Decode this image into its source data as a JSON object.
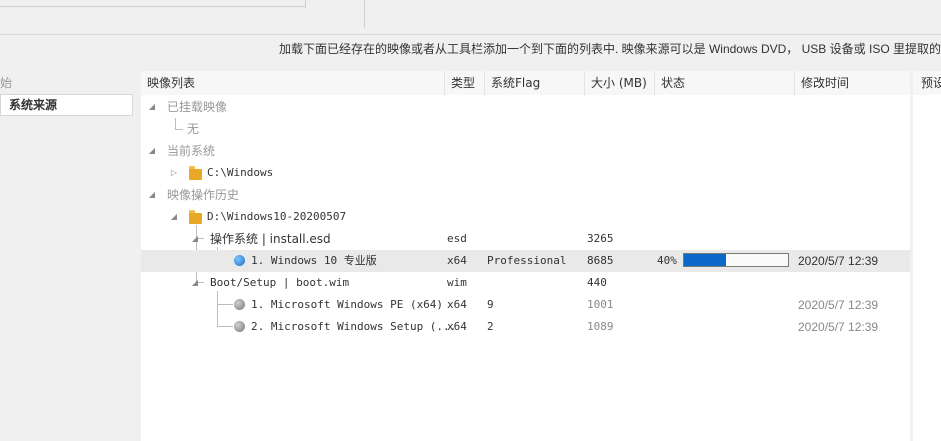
{
  "hint_text": "加载下面已经存在的映像或者从工具栏添加一个到下面的列表中. 映像来源可以是 Windows DVD， USB 设备或 ISO 里提取的",
  "sidebar": {
    "head_label": "始",
    "items": [
      {
        "label": "系统来源"
      }
    ]
  },
  "table": {
    "columns": [
      "映像列表",
      "类型",
      "系统Flag",
      "大小 (MB)",
      "状态",
      "修改时间"
    ],
    "right_header": "预设"
  },
  "tree": {
    "mounted": {
      "label": "已挂载映像",
      "child": "无"
    },
    "current": {
      "label": "当前系统",
      "child": "C:\\Windows"
    },
    "history": {
      "label": "映像操作历史",
      "folder": "D:\\Windows10-20200507",
      "groups": [
        {
          "label": "操作系统  |  install.esd",
          "type": "esd",
          "size": "3265",
          "items": [
            {
              "name": "1. Windows 10 专业版",
              "type": "x64",
              "flag": "Professional",
              "size": "8685",
              "status": "40%",
              "progress": 0.4,
              "time": "2020/5/7 12:39"
            }
          ]
        },
        {
          "label": "Boot/Setup  |  boot.wim",
          "type": "wim",
          "size": "440",
          "items": [
            {
              "name": "1. Microsoft Windows PE (x64)",
              "type": "x64",
              "flag": "9",
              "size": "1001",
              "status": "",
              "time": "2020/5/7 12:39"
            },
            {
              "name": "2. Microsoft Windows Setup (...",
              "type": "x64",
              "flag": "2",
              "size": "1089",
              "status": "",
              "time": "2020/5/7 12:39"
            }
          ]
        }
      ]
    }
  },
  "colors": {
    "progress_fill": "#0a68c8",
    "selected_row": "#e9e9e9"
  }
}
